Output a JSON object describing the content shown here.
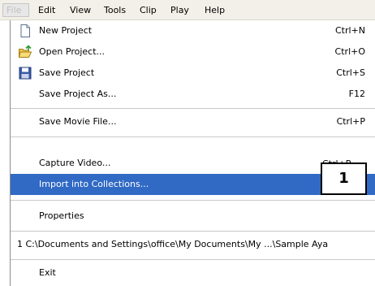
{
  "menubar": {
    "items": [
      {
        "label": "File",
        "active": true
      },
      {
        "label": "Edit"
      },
      {
        "label": "View"
      },
      {
        "label": "Tools"
      },
      {
        "label": "Clip"
      },
      {
        "label": "Play"
      },
      {
        "label": "Help"
      }
    ]
  },
  "file_menu": {
    "new_project": {
      "label": "New Project",
      "shortcut": "Ctrl+N",
      "icon": "new-document-icon"
    },
    "open_project": {
      "label": "Open Project...",
      "shortcut": "Ctrl+O",
      "icon": "open-folder-icon"
    },
    "save_project": {
      "label": "Save Project",
      "shortcut": "Ctrl+S",
      "icon": "floppy-disk-icon"
    },
    "save_project_as": {
      "label": "Save Project As...",
      "shortcut": "F12"
    },
    "save_movie_file": {
      "label": "Save Movie File...",
      "shortcut": "Ctrl+P"
    },
    "capture_video": {
      "label": "Capture Video...",
      "shortcut": "Ctrl+R"
    },
    "import_into_collections": {
      "label": "Import into Collections...",
      "shortcut": "",
      "highlighted": true
    },
    "properties": {
      "label": "Properties"
    },
    "recent_file": {
      "label": "1 C:\\Documents and Settings\\office\\My Documents\\My ...\\Sample Aya"
    },
    "exit": {
      "label": "Exit"
    }
  },
  "callout": {
    "label": "1"
  },
  "colors": {
    "highlight": "#316ac5",
    "menubar_bg": "#f2f0e8",
    "separator": "#c8c8c8"
  }
}
